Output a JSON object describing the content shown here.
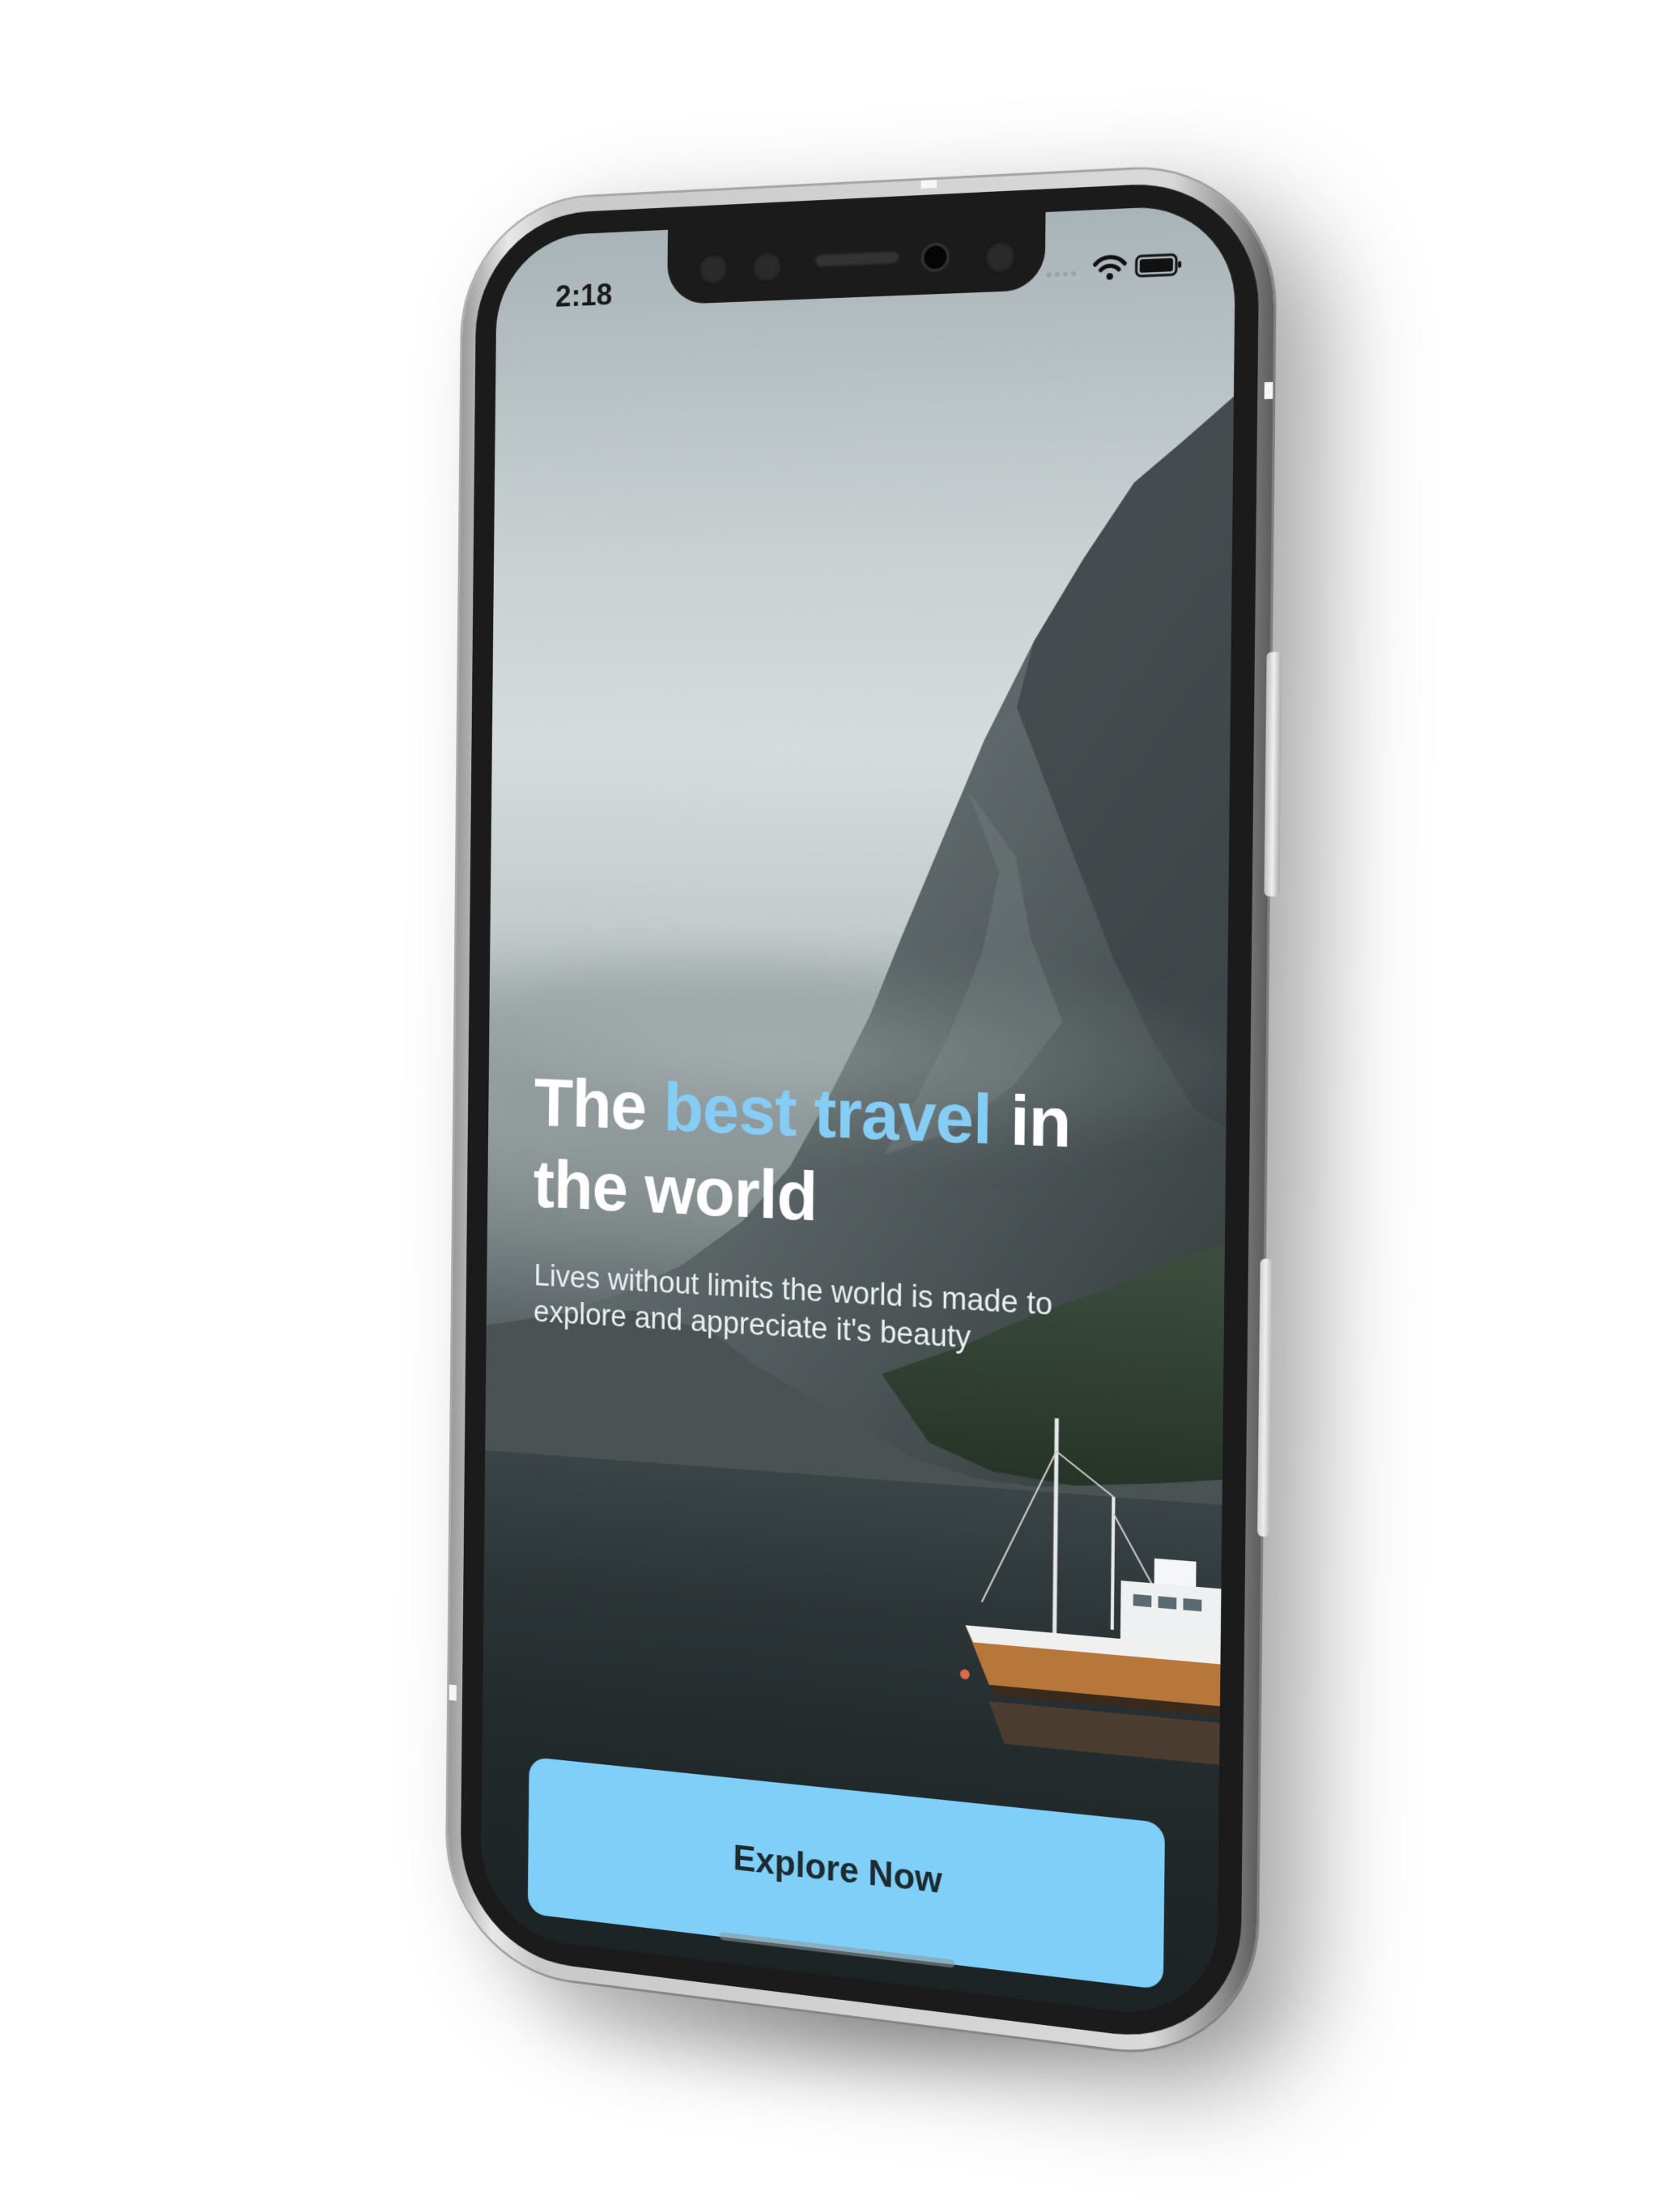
{
  "status_bar": {
    "time": "2:18",
    "icons": [
      "signal-icon",
      "wifi-icon",
      "battery-icon"
    ]
  },
  "hero": {
    "headline_part1": "The ",
    "headline_accent": "best travel",
    "headline_part2": " in the world",
    "subtitle": "Lives without limits the world is made to explore and appreciate it's beauty"
  },
  "cta": {
    "label": "Explore Now"
  },
  "colors": {
    "accent": "#86cdf5",
    "button": "#7fcff8",
    "button_text": "#1d2a30",
    "headline": "#ffffff"
  }
}
